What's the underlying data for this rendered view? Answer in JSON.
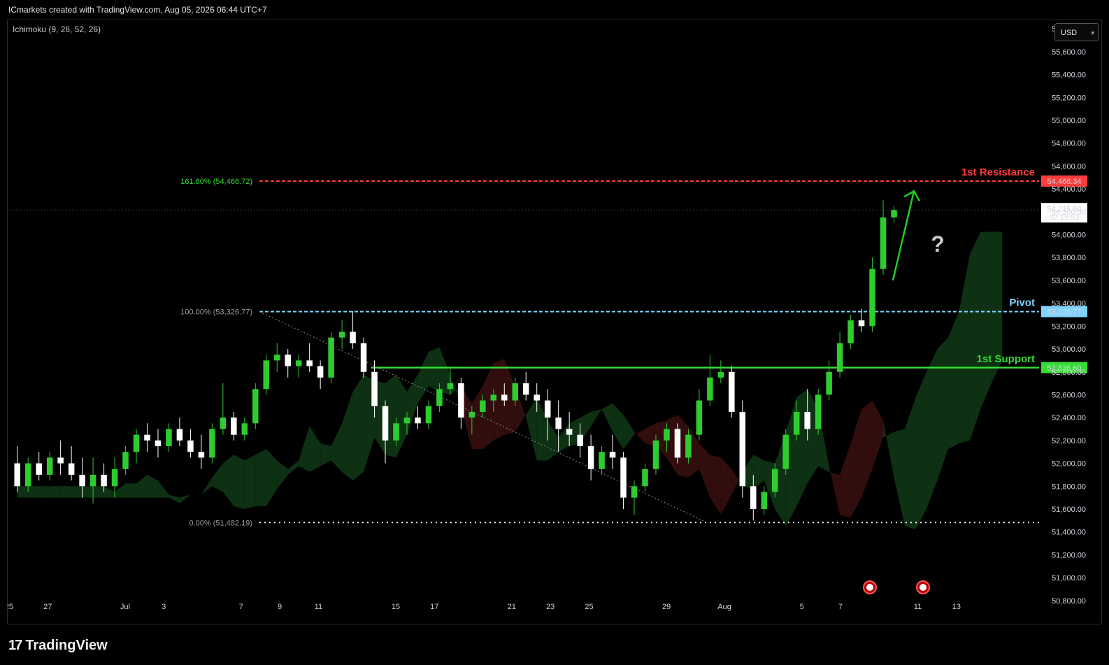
{
  "header": {
    "watermark": "ICmarkets created with TradingView.com, Aug 05, 2026 06:44 UTC+7",
    "indicator": "Ichimoku (9, 26, 52, 26)",
    "currency": "USD"
  },
  "footer": {
    "logo": "TradingView"
  },
  "colors": {
    "up": "#2ecc2e",
    "down": "#ffffff",
    "resistance": "#ff3b3b",
    "pivot": "#7fd4ff",
    "support": "#33dd33",
    "arrow": "#22cc22",
    "cloud_bull": "#0f3a15",
    "cloud_bear": "#3a0f0f"
  },
  "chart_data": {
    "type": "candlestick",
    "y_axis": {
      "ylim": [
        50750,
        55850
      ],
      "ticks": [
        50800,
        51000,
        51200,
        51400,
        51600,
        51800,
        52000,
        52200,
        52400,
        52600,
        52800,
        53000,
        53200,
        53400,
        53600,
        53800,
        54000,
        54200,
        54400,
        54600,
        54800,
        55000,
        55200,
        55400,
        55600,
        55800
      ],
      "tick_labels": [
        "50,800.00",
        "51,000.00",
        "51,200.00",
        "51,400.00",
        "51,600.00",
        "51,800.00",
        "52,000.00",
        "52,200.00",
        "52,400.00",
        "52,600.00",
        "52,800.00",
        "53,000.00",
        "53,200.00",
        "53,400.00",
        "53,600.00",
        "53,800.00",
        "54,000.00",
        "54,200.00",
        "54,400.00",
        "54,600.00",
        "54,800.00",
        "55,000.00",
        "55,200.00",
        "55,400.00",
        "55,600.00",
        "55,800.00"
      ]
    },
    "x_axis": {
      "labels": [
        {
          "label": "25",
          "day": 0
        },
        {
          "label": "27",
          "day": 2
        },
        {
          "label": "Jul",
          "day": 6
        },
        {
          "label": "3",
          "day": 8
        },
        {
          "label": "7",
          "day": 12
        },
        {
          "label": "9",
          "day": 14
        },
        {
          "label": "11",
          "day": 16
        },
        {
          "label": "15",
          "day": 20
        },
        {
          "label": "17",
          "day": 22
        },
        {
          "label": "21",
          "day": 26
        },
        {
          "label": "23",
          "day": 28
        },
        {
          "label": "25",
          "day": 30
        },
        {
          "label": "29",
          "day": 34
        },
        {
          "label": "Aug",
          "day": 37
        },
        {
          "label": "5",
          "day": 41
        },
        {
          "label": "7",
          "day": 43
        },
        {
          "label": "11",
          "day": 47
        },
        {
          "label": "13",
          "day": 49
        }
      ]
    },
    "levels": [
      {
        "name": "1st Resistance",
        "value": 54468.34,
        "value_label": "54,468.34",
        "fib_label": "161.80% (54,466.72)",
        "style": "dashed",
        "color_key": "resistance"
      },
      {
        "name": "Pivot",
        "value": 53326.77,
        "value_label": "53,326.77",
        "fib_label": "100.00% (53,326.77)",
        "style": "dashed",
        "color_key": "pivot"
      },
      {
        "name": "1st Support",
        "value": 52836.6,
        "value_label": "52,836.60",
        "fib_label": "",
        "style": "solid",
        "color_key": "support"
      },
      {
        "name": "",
        "value": 51482.19,
        "value_label": "",
        "fib_label": "0.00% (51,482.19)",
        "style": "dotted",
        "color_key": "down"
      }
    ],
    "current_price": {
      "value": 54215.6,
      "label": "54,215.60",
      "countdown": "02:15:53"
    },
    "annotation": {
      "text": "?"
    },
    "series_ohlc": [
      [
        52000,
        52150,
        51750,
        51800
      ],
      [
        51800,
        52050,
        51750,
        52000
      ],
      [
        52000,
        52100,
        51850,
        51900
      ],
      [
        51900,
        52100,
        51850,
        52050
      ],
      [
        52050,
        52200,
        51900,
        52000
      ],
      [
        52000,
        52150,
        51850,
        51900
      ],
      [
        51900,
        52050,
        51700,
        51800
      ],
      [
        51800,
        52050,
        51650,
        51900
      ],
      [
        51900,
        52000,
        51750,
        51800
      ],
      [
        51800,
        52050,
        51700,
        51950
      ],
      [
        51950,
        52150,
        51900,
        52100
      ],
      [
        52100,
        52300,
        52000,
        52250
      ],
      [
        52250,
        52350,
        52100,
        52200
      ],
      [
        52200,
        52300,
        52050,
        52150
      ],
      [
        52150,
        52350,
        52100,
        52300
      ],
      [
        52300,
        52400,
        52150,
        52200
      ],
      [
        52200,
        52300,
        52050,
        52100
      ],
      [
        52100,
        52250,
        51950,
        52050
      ],
      [
        52050,
        52350,
        52000,
        52300
      ],
      [
        52300,
        52700,
        52250,
        52400
      ],
      [
        52400,
        52450,
        52200,
        52250
      ],
      [
        52250,
        52400,
        52200,
        52350
      ],
      [
        52350,
        52700,
        52300,
        52650
      ],
      [
        52650,
        52950,
        52600,
        52900
      ],
      [
        52900,
        53050,
        52800,
        52950
      ],
      [
        52950,
        53000,
        52750,
        52850
      ],
      [
        52850,
        52950,
        52750,
        52900
      ],
      [
        52900,
        53050,
        52800,
        52850
      ],
      [
        52850,
        52900,
        52650,
        52750
      ],
      [
        52750,
        53150,
        52700,
        53100
      ],
      [
        53100,
        53250,
        53000,
        53150
      ],
      [
        53150,
        53330,
        53000,
        53050
      ],
      [
        53050,
        53100,
        52750,
        52800
      ],
      [
        52800,
        52900,
        52400,
        52500
      ],
      [
        52500,
        52550,
        52000,
        52200
      ],
      [
        52200,
        52400,
        52150,
        52350
      ],
      [
        52350,
        52450,
        52250,
        52400
      ],
      [
        52400,
        52500,
        52300,
        52350
      ],
      [
        52350,
        52550,
        52300,
        52500
      ],
      [
        52500,
        52700,
        52450,
        52650
      ],
      [
        52650,
        52850,
        52600,
        52700
      ],
      [
        52700,
        52750,
        52300,
        52400
      ],
      [
        52400,
        52500,
        52250,
        52450
      ],
      [
        52450,
        52600,
        52400,
        52550
      ],
      [
        52550,
        52650,
        52450,
        52600
      ],
      [
        52600,
        52700,
        52500,
        52550
      ],
      [
        52550,
        52750,
        52500,
        52700
      ],
      [
        52700,
        52800,
        52550,
        52600
      ],
      [
        52600,
        52700,
        52450,
        52550
      ],
      [
        52550,
        52650,
        52200,
        52400
      ],
      [
        52400,
        52550,
        52100,
        52300
      ],
      [
        52300,
        52450,
        52150,
        52250
      ],
      [
        52250,
        52350,
        52050,
        52150
      ],
      [
        52150,
        52250,
        51850,
        51950
      ],
      [
        51950,
        52150,
        51900,
        52100
      ],
      [
        52100,
        52250,
        51950,
        52050
      ],
      [
        52050,
        52100,
        51600,
        51700
      ],
      [
        51700,
        51850,
        51550,
        51800
      ],
      [
        51800,
        52000,
        51750,
        51950
      ],
      [
        51950,
        52250,
        51900,
        52200
      ],
      [
        52200,
        52350,
        52100,
        52300
      ],
      [
        52300,
        52350,
        52000,
        52050
      ],
      [
        52050,
        52300,
        52000,
        52250
      ],
      [
        52250,
        52650,
        52200,
        52550
      ],
      [
        52550,
        52950,
        52500,
        52750
      ],
      [
        52750,
        52900,
        52700,
        52800
      ],
      [
        52800,
        52850,
        52400,
        52450
      ],
      [
        52450,
        52550,
        51700,
        51800
      ],
      [
        51800,
        51900,
        51500,
        51600
      ],
      [
        51600,
        51800,
        51550,
        51750
      ],
      [
        51750,
        52000,
        51700,
        51950
      ],
      [
        51950,
        52300,
        51900,
        52250
      ],
      [
        52250,
        52550,
        52200,
        52450
      ],
      [
        52450,
        52650,
        52200,
        52300
      ],
      [
        52300,
        52650,
        52250,
        52600
      ],
      [
        52600,
        52900,
        52550,
        52800
      ],
      [
        52800,
        53150,
        52750,
        53050
      ],
      [
        53050,
        53300,
        53000,
        53250
      ],
      [
        53250,
        53350,
        53150,
        53200
      ],
      [
        53200,
        53800,
        53150,
        53700
      ],
      [
        53700,
        54300,
        53650,
        54150
      ],
      [
        54150,
        54250,
        54100,
        54215.6
      ]
    ]
  }
}
